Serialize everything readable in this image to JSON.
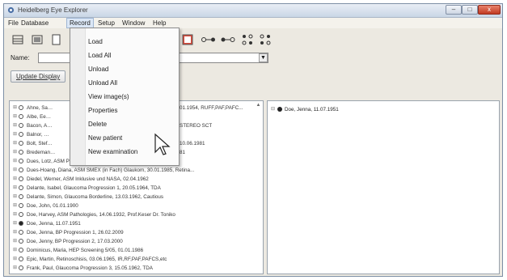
{
  "window": {
    "title": "Heidelberg Eye Explorer",
    "buttons": {
      "minimize": "–",
      "maximize": "□",
      "close": "x"
    }
  },
  "menubar": [
    "File",
    "Database",
    "Record",
    "Setup",
    "Window",
    "Help"
  ],
  "toolbar": {
    "icons": [
      "database-icon",
      "database-stack-icon",
      "document-icon",
      "exam-icon",
      "link-node-icon",
      "link-node-alt-icon",
      "grid-node-icon",
      "grid-node-alt-icon"
    ]
  },
  "name_row": {
    "label": "Name:",
    "value": ""
  },
  "update_button": "Update Display",
  "record_menu": [
    "Load",
    "Load All",
    "Unload",
    "Unload All",
    "View image(s)",
    "Properties",
    "Delete",
    "New patient",
    "New examination"
  ],
  "patient_list": [
    {
      "text": "Ahne, Sa…",
      "suffix": "01.1954, RUFF,PAF,PAFC...",
      "filled": false
    },
    {
      "text": "Albe, Ee…",
      "suffix": "",
      "filled": false
    },
    {
      "text": "Bacon, A…",
      "suffix": "STEREO SCT",
      "filled": false
    },
    {
      "text": "Balnor, …",
      "suffix": "",
      "filled": false
    },
    {
      "text": "Bolt, Stef…",
      "suffix": "10.06.1981",
      "filled": false
    },
    {
      "text": "Bredeman…",
      "suffix": "81",
      "filled": false
    },
    {
      "text": "Dues, Lotz, ASM Pathologies, 10.06.1981, IR Studien",
      "suffix": "",
      "filled": false
    },
    {
      "text": "Dues-Hoang, Diana, ASM SMEX (in Fach) Glaukom, 30.01.1985, Retina...",
      "suffix": "",
      "filled": false
    },
    {
      "text": "Diedel, Werner, ASM Inklusive und NASA, 02.04.1962",
      "suffix": "",
      "filled": false
    },
    {
      "text": "Delante, Isabel, Glaucoma Progression 1, 20.05.1964, TDA",
      "suffix": "",
      "filled": false
    },
    {
      "text": "Delante, Simon, Glaucoma Borderline, 13.03.1962, Cautious",
      "suffix": "",
      "filled": false
    },
    {
      "text": "Doe, John, 01.01.1900",
      "suffix": "",
      "filled": false
    },
    {
      "text": "Doe, Harvey, ASM Pathologies, 14.06.1932, Prof.Keser Dr. Toniko",
      "suffix": "",
      "filled": false
    },
    {
      "text": "Doe, Jenna, 11.07.1951",
      "suffix": "",
      "filled": true
    },
    {
      "text": "Doe, Jenna, BP Progression 1, 26.02.2009",
      "suffix": "",
      "filled": false
    },
    {
      "text": "Doe, Jenny, BP Progression 2, 17.03.2000",
      "suffix": "",
      "filled": false
    },
    {
      "text": "Dominicus, Maria, HEP Screening 5/05, 01.01.1986",
      "suffix": "",
      "filled": false
    },
    {
      "text": "Epic, Martin, Retinoschisis, 03.06.1965, IR,RF,PAF,PAFCS,etc",
      "suffix": "",
      "filled": false
    },
    {
      "text": "Frank, Paul, Glaucoma Progression 3, 15.05.1962, TDA",
      "suffix": "",
      "filled": false
    }
  ],
  "right_pane": {
    "text": "Doe, Jenna, 11.07.1951"
  },
  "colors": {
    "accent": "#dbe7f6",
    "title_bar": "#c9d6e6",
    "close": "#c13a22"
  }
}
